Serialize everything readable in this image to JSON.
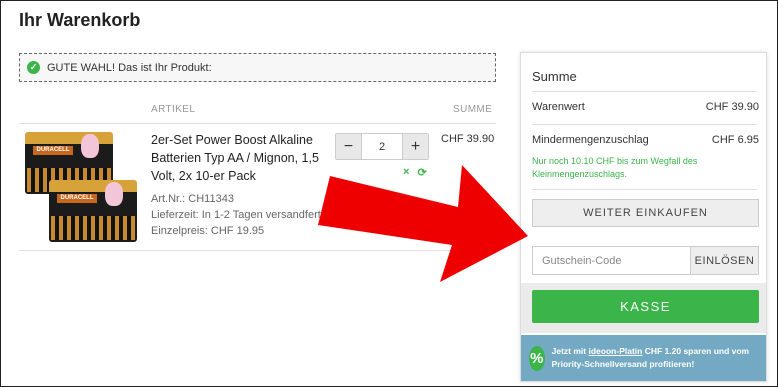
{
  "page": {
    "title": "Ihr Warenkorb"
  },
  "notice": {
    "icon": "check-circle-icon",
    "text": "GUTE WAHL! Das ist Ihr Produkt:"
  },
  "table": {
    "col_article": "ARTIKEL",
    "col_sum": "SUMME"
  },
  "item": {
    "image": "duracell-battery-pack-image",
    "image_brand": "DURACELL",
    "name": "2er-Set Power Boost Alkaline Batterien Typ AA / Mignon, 1,5 Volt, 2x 10-er Pack",
    "article_no": "Art.Nr.: CH11343",
    "delivery": "Lieferzeit: In 1-2 Tagen versandfertig",
    "unit_price": "Einzelpreis: CHF 19.95",
    "quantity": "2",
    "minus": "−",
    "plus": "+",
    "remove_icon": "×",
    "refresh_icon": "⟳",
    "price": "CHF 39.90"
  },
  "summary": {
    "title": "Summe",
    "goods_label": "Warenwert",
    "goods_value": "CHF 39.90",
    "surcharge_label": "Mindermengenzuschlag",
    "surcharge_value": "CHF 6.95",
    "surcharge_note": "Nur noch 10.10 CHF bis zum Wegfall des Kleinmengenzuschlags.",
    "continue_label": "WEITER EINKAUFEN",
    "voucher_placeholder": "Gutschein-Code",
    "redeem_label": "EINLÖSEN",
    "checkout_label": "KASSE"
  },
  "promo": {
    "badge": "%",
    "prefix": "Jetzt mit",
    "link": "ideoon-Platin",
    "suffix": "CHF 1.20 sparen und vom Priority-Schnellversand profitieren!"
  },
  "colors": {
    "accent_green": "#3bb54a",
    "arrow_red": "#ee0000",
    "promo_blue": "#73a9c2"
  }
}
